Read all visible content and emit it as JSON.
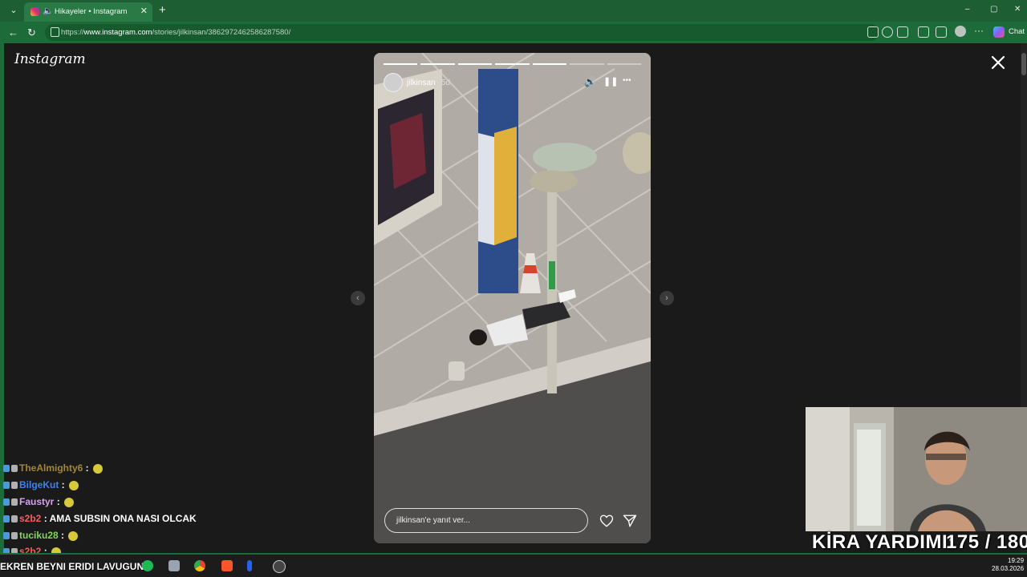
{
  "browser": {
    "tab_title": "Hikayeler • Instagram",
    "url_prefix": "https://",
    "url_host": "www.instagram.com",
    "url_path": "/stories/jilkinsan/3862972462586287580/",
    "chat_label": "Chat",
    "new_tab_symbol": "+",
    "tab_close_symbol": "✕",
    "back_symbol": "←",
    "reload_symbol": "↻",
    "minimize_symbol": "–",
    "maximize_symbol": "▢",
    "close_symbol": "✕",
    "more_symbol": "···"
  },
  "instagram": {
    "logo": "Instagram"
  },
  "story": {
    "username": "jilkinsan",
    "time": "5d",
    "reply_placeholder": "jilkinsan'e yanıt ver...",
    "segments": [
      1,
      1,
      1,
      1,
      1,
      0,
      0
    ],
    "mute_symbol": "🔊",
    "pause_symbol": "❚❚",
    "more_symbol": "•••"
  },
  "nav": {
    "prev_symbol": "‹",
    "next_symbol": "›"
  },
  "chat_messages": [
    {
      "user": "TheAlmighty6",
      "text": "",
      "color": "#a0863a"
    },
    {
      "user": "BilgeKut",
      "text": "",
      "color": "#3b82f6"
    },
    {
      "user": "Faustyr",
      "text": "",
      "color": "#d7a2f0"
    },
    {
      "user": "s2b2",
      "text": "AMA SUBSIN ONA NASI OLCAK",
      "color": "#ff5a5a"
    },
    {
      "user": "tuciku28",
      "text": "",
      "color": "#7ed957"
    },
    {
      "user": "s2b2",
      "text": "",
      "color": "#ff5a5a"
    }
  ],
  "overlay": {
    "kira": "KİRA YARDIMI:",
    "kira_value": "175 / 180",
    "ticker": "EKREN BEYNI ERIDI LAVUGUN"
  },
  "clock": {
    "time": "19:29",
    "date": "28.03.2026"
  },
  "colors": {
    "chrome": "#1e6b3a",
    "page_bg": "#1a1a1a"
  }
}
